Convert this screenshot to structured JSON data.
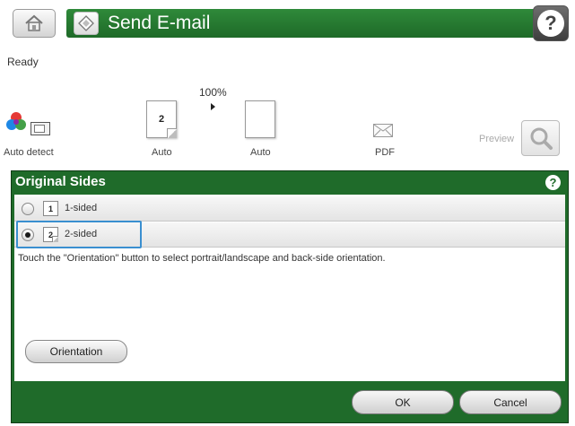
{
  "header": {
    "title": "Send E-mail",
    "home_icon": "home-icon",
    "app_icon": "email-diamond-icon",
    "help_icon": "help-icon",
    "help_glyph": "?"
  },
  "status": {
    "ready_text": "Ready",
    "zoom_text": "100%",
    "color_label": "Auto detect",
    "sides_label": "Auto",
    "sides_number": "2",
    "size_label": "Auto",
    "format_label": "PDF",
    "preview_label": "Preview"
  },
  "dialog": {
    "title": "Original Sides",
    "help_glyph": "?",
    "options": [
      {
        "number": "1",
        "label": "1-sided",
        "selected": false
      },
      {
        "number": "2",
        "label": "2-sided",
        "selected": true
      }
    ],
    "instruction": "Touch the \"Orientation\" button to select portrait/landscape and back-side orientation.",
    "orientation_label": "Orientation",
    "ok_label": "OK",
    "cancel_label": "Cancel"
  },
  "colors": {
    "green": "#1f6b2a",
    "title_green": "#2f8a3a",
    "selection_blue": "#3a8fd0"
  }
}
